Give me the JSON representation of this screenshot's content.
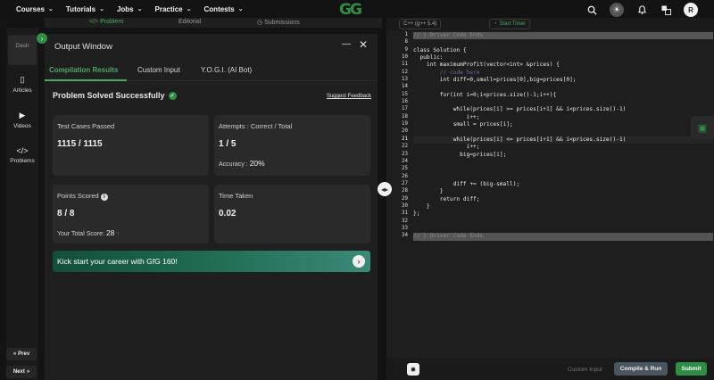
{
  "topnav": {
    "items": [
      "Courses",
      "Tutorials",
      "Jobs",
      "Practice",
      "Contests"
    ],
    "logo": "GG",
    "avatar_letter": "R"
  },
  "sidebar": {
    "items": [
      {
        "label": "Dash",
        "icon": "dashboard-icon"
      },
      {
        "label": "Articles",
        "icon": "book-icon"
      },
      {
        "label": "Videos",
        "icon": "video-icon"
      },
      {
        "label": "Problems",
        "icon": "code-icon"
      }
    ],
    "prev_label": "Prev",
    "next_label": "Next"
  },
  "problem_tabs": [
    "Problem",
    "Editorial",
    "Submissions"
  ],
  "output_window": {
    "title": "Output Window",
    "tabs": [
      "Compilation Results",
      "Custom Input",
      "Y.O.G.I. (AI Bot)"
    ],
    "status": "Problem Solved Successfully",
    "suggest_feedback": "Suggest Feedback",
    "cards": {
      "test_cases": {
        "label": "Test Cases Passed",
        "value": "1115 / 1115"
      },
      "attempts": {
        "label": "Attempts : Correct / Total",
        "value": "1 / 5",
        "accuracy_label": "Accuracy :",
        "accuracy_value": "20%"
      },
      "points": {
        "label": "Points Scored",
        "value": "8 / 8",
        "total_label": "Your Total Score:",
        "total_value": "28"
      },
      "time": {
        "label": "Time Taken",
        "value": "0.02"
      }
    },
    "banner": "Kick start your career with GfG 160!"
  },
  "editor": {
    "language": "C++ (g++ 5.4)",
    "timer_label": "Start Timer",
    "line_numbers": [
      "1",
      "8",
      "9",
      "10",
      "11",
      "12",
      "13",
      "14",
      "15",
      "16",
      "17",
      "18",
      "19",
      "20",
      "21",
      "22",
      "23",
      "24",
      "25",
      "26",
      "27",
      "28",
      "29",
      "30",
      "31",
      "32",
      "33",
      "34"
    ],
    "lines": [
      "// } Driver Code Ends",
      "",
      "class Solution {",
      "  public:",
      "    int maximumProfit(vector<int> &prices) {",
      "        // code here",
      "        int diff=0,small=prices[0],big=prices[0];",
      "",
      "        for(int i=0;i<prices.size()-1;i++){",
      "",
      "            while(prices[i] >= prices[i+1] && i<prices.size()-1)",
      "                i++;",
      "            small = prices[i];",
      "",
      "            while(prices[i] <= prices[i+1] && i<prices.size()-1)",
      "                i++;",
      "              big=prices[i];",
      "",
      "",
      "",
      "            diff += (big-small);",
      "        }",
      "        return diff;",
      "    }",
      "};",
      "",
      "",
      "// } Driver Code Ends"
    ],
    "custom_input_label": "Custom Input",
    "compile_label": "Compile & Run",
    "submit_label": "Submit"
  }
}
